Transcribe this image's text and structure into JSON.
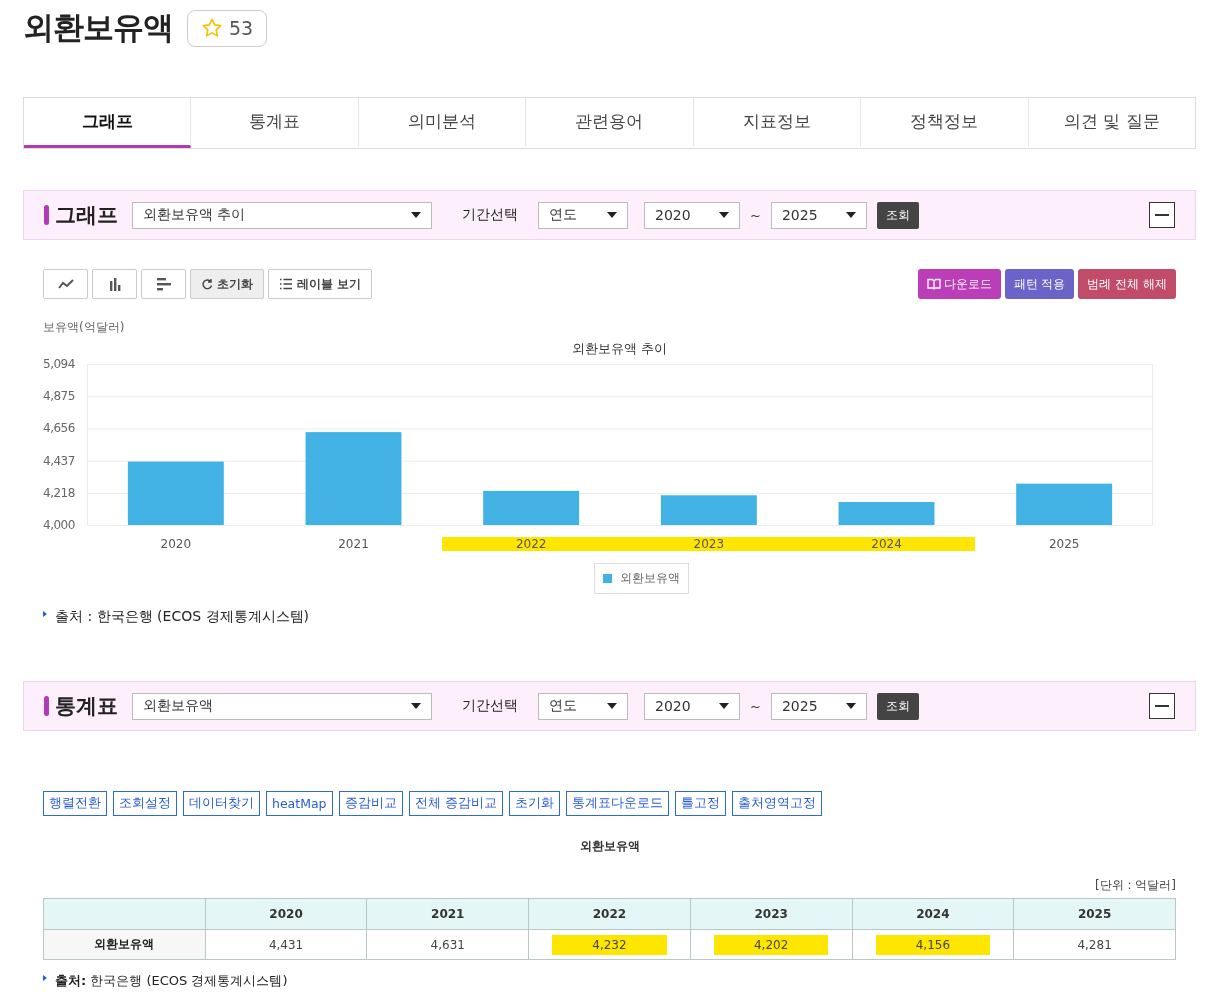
{
  "title": "외환보유액",
  "favorite": {
    "count": "53"
  },
  "tabs": [
    {
      "label": "그래프",
      "selected": true
    },
    {
      "label": "통계표",
      "selected": false
    },
    {
      "label": "의미분석",
      "selected": false
    },
    {
      "label": "관련용어",
      "selected": false
    },
    {
      "label": "지표정보",
      "selected": false
    },
    {
      "label": "정책정보",
      "selected": false
    },
    {
      "label": "의견 및 질문",
      "selected": false
    }
  ],
  "graph_panel": {
    "heading": "그래프",
    "series_select": "외환보유액 추이",
    "period_label": "기간선택",
    "period_type": "연도",
    "from": "2020",
    "tilde": "~",
    "to": "2025",
    "query_button": "조회"
  },
  "graph_toolbar": {
    "reset_button": "초기화",
    "label_button": "레이블 보기",
    "download_button": "다운로드",
    "pattern_button": "패턴 적용",
    "legend_button": "범례 전체 해제"
  },
  "chart_data": {
    "type": "bar",
    "title": "외환보유액 추이",
    "ylabel": "보유액(억달러)",
    "categories": [
      "2020",
      "2021",
      "2022",
      "2023",
      "2024",
      "2025"
    ],
    "series": [
      {
        "name": "외환보유액",
        "color": "#42b2e5",
        "values": [
          4431,
          4631,
          4232,
          4202,
          4156,
          4281
        ]
      }
    ],
    "ylim": [
      4000,
      5094
    ],
    "grid": true,
    "yticks": [
      {
        "value": 4000,
        "label": "4,000"
      },
      {
        "value": 4218,
        "label": "4,218"
      },
      {
        "value": 4437,
        "label": "4,437"
      },
      {
        "value": 4656,
        "label": "4,656"
      },
      {
        "value": 4875,
        "label": "4,875"
      },
      {
        "value": 5094,
        "label": "5,094"
      }
    ]
  },
  "chart_highlights": [
    false,
    false,
    true,
    true,
    true,
    false
  ],
  "chart_source": "출처 : 한국은행 (ECOS 경제통계시스템)",
  "table_panel": {
    "heading": "통계표",
    "series_select": "외환보유액",
    "period_label": "기간선택",
    "period_type": "연도",
    "from": "2020",
    "tilde": "~",
    "to": "2025",
    "query_button": "조회"
  },
  "table_tools": [
    "행렬전환",
    "조회설정",
    "데이터찾기",
    "heatMap",
    "증감비교",
    "전체 증감비교",
    "초기화",
    "통계표다운로드",
    "틀고정",
    "출처영역고정"
  ],
  "table": {
    "title": "외환보유액",
    "unit": "[단위 : 억달러]",
    "columns": [
      "2020",
      "2021",
      "2022",
      "2023",
      "2024",
      "2025"
    ],
    "rows": [
      {
        "label": "외환보유액",
        "cells": [
          {
            "value": "4,431",
            "highlighted": false
          },
          {
            "value": "4,631",
            "highlighted": false
          },
          {
            "value": "4,232",
            "highlighted": true
          },
          {
            "value": "4,202",
            "highlighted": true
          },
          {
            "value": "4,156",
            "highlighted": true
          },
          {
            "value": "4,281",
            "highlighted": false
          }
        ]
      }
    ]
  },
  "table_source": "**출처:** 한국은행 (ECOS 경제통계시스템)"
}
